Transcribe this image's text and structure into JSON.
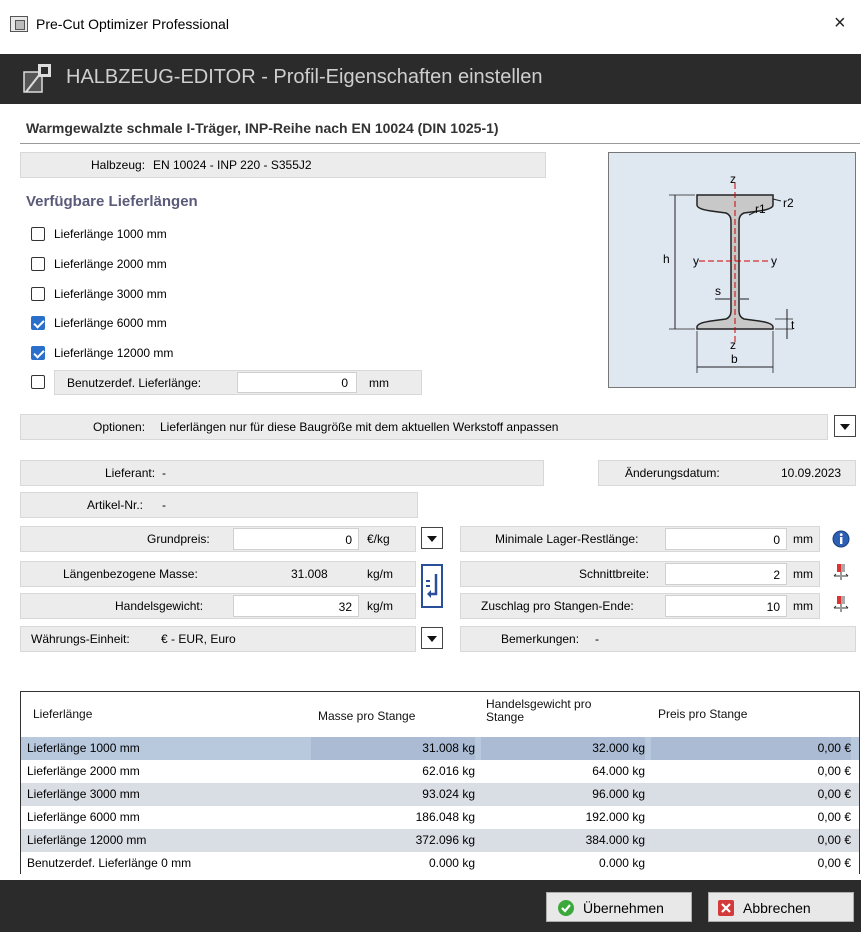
{
  "window": {
    "title": "Pre-Cut Optimizer Professional",
    "close": "×"
  },
  "header": {
    "title": "HALBZEUG-EDITOR - Profil-Eigenschaften einstellen"
  },
  "subtitle": "Warmgewalzte schmale I-Träger, INP-Reihe nach EN 10024 (DIN 1025-1)",
  "halbzeug": {
    "label": "Halbzeug:",
    "value": "EN 10024 - INP 220 - S355J2"
  },
  "lengths": {
    "heading": "Verfügbare Lieferlängen",
    "items": [
      {
        "label": "Lieferlänge 1000 mm",
        "checked": false
      },
      {
        "label": "Lieferlänge 2000 mm",
        "checked": false
      },
      {
        "label": "Lieferlänge 3000 mm",
        "checked": false
      },
      {
        "label": "Lieferlänge 6000 mm",
        "checked": true
      },
      {
        "label": "Lieferlänge 12000 mm",
        "checked": true
      }
    ],
    "custom": {
      "label": "Benutzerdef. Lieferlänge:",
      "value": "0",
      "unit": "mm",
      "checked": false
    }
  },
  "profile_labels": {
    "z_top": "z",
    "z_bottom": "z",
    "r2": "r2",
    "r1": "r1",
    "h": "h",
    "y_left": "y",
    "y_right": "y",
    "s": "s",
    "t": "t",
    "b": "b"
  },
  "options": {
    "label": "Optionen:",
    "value": "Lieferlängen nur für diese Baugröße mit dem aktuellen Werkstoff anpassen"
  },
  "lieferant": {
    "label": "Lieferant:",
    "value": "-"
  },
  "aenderung": {
    "label": "Änderungsdatum:",
    "value": "10.09.2023"
  },
  "artikel": {
    "label": "Artikel-Nr.:",
    "value": "-"
  },
  "grundpreis": {
    "label": "Grundpreis:",
    "value": "0",
    "unit": "€/kg"
  },
  "masse": {
    "label": "Längenbezogene Masse:",
    "value": "31.008",
    "unit": "kg/m"
  },
  "handelsgewicht": {
    "label": "Handelsgewicht:",
    "value": "32",
    "unit": "kg/m"
  },
  "waehrung": {
    "label": "Währungs-Einheit:",
    "value": "€ - EUR, Euro"
  },
  "restlaenge": {
    "label": "Minimale Lager-Restlänge:",
    "value": "0",
    "unit": "mm"
  },
  "schnittbreite": {
    "label": "Schnittbreite:",
    "value": "2",
    "unit": "mm"
  },
  "zuschlag": {
    "label": "Zuschlag pro Stangen-Ende:",
    "value": "10",
    "unit": "mm"
  },
  "bemerkungen": {
    "label": "Bemerkungen:",
    "value": "-"
  },
  "table": {
    "headers": [
      "Lieferlänge",
      "Masse pro Stange",
      "Handelsgewicht pro Stange",
      "Preis pro Stange"
    ],
    "rows": [
      [
        "Lieferlänge 1000 mm",
        "31.008 kg",
        "32.000 kg",
        "0,00 €"
      ],
      [
        "Lieferlänge 2000 mm",
        "62.016 kg",
        "64.000 kg",
        "0,00 €"
      ],
      [
        "Lieferlänge 3000 mm",
        "93.024 kg",
        "96.000 kg",
        "0,00 €"
      ],
      [
        "Lieferlänge 6000 mm",
        "186.048 kg",
        "192.000 kg",
        "0,00 €"
      ],
      [
        "Lieferlänge 12000 mm",
        "372.096 kg",
        "384.000 kg",
        "0,00 €"
      ],
      [
        "Benutzerdef. Lieferlänge 0 mm",
        "0.000 kg",
        "0.000 kg",
        "0,00 €"
      ]
    ]
  },
  "buttons": {
    "ok": "Übernehmen",
    "cancel": "Abbrechen"
  },
  "colors": {
    "banner": "#2b2b2b",
    "selected_row": "#b8c9de",
    "shaded_col": "#d9dde4",
    "checkbox": "#2a6fc9"
  }
}
